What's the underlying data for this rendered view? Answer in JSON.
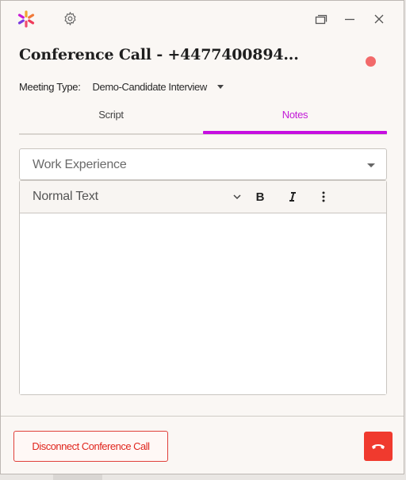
{
  "call": {
    "title": "Conference Call - +4477400894..."
  },
  "meeting": {
    "label": "Meeting Type:",
    "value": "Demo-Candidate Interview"
  },
  "tabs": [
    {
      "label": "Script",
      "active": false
    },
    {
      "label": "Notes",
      "active": true
    }
  ],
  "notes": {
    "section_select": "Work Experience",
    "format_select": "Normal Text",
    "bold_label": "B"
  },
  "footer": {
    "disconnect_label": "Disconnect Conference Call"
  },
  "colors": {
    "accent": "#c60ee0",
    "danger": "#f03a2e",
    "status_dot": "#f26a6a"
  },
  "icons": {
    "logo": "brand-asterisk-icon",
    "settings": "gear-icon",
    "restore": "restore-window-icon",
    "minimize": "minimize-icon",
    "close": "close-icon",
    "hangup": "phone-hangup-icon"
  }
}
